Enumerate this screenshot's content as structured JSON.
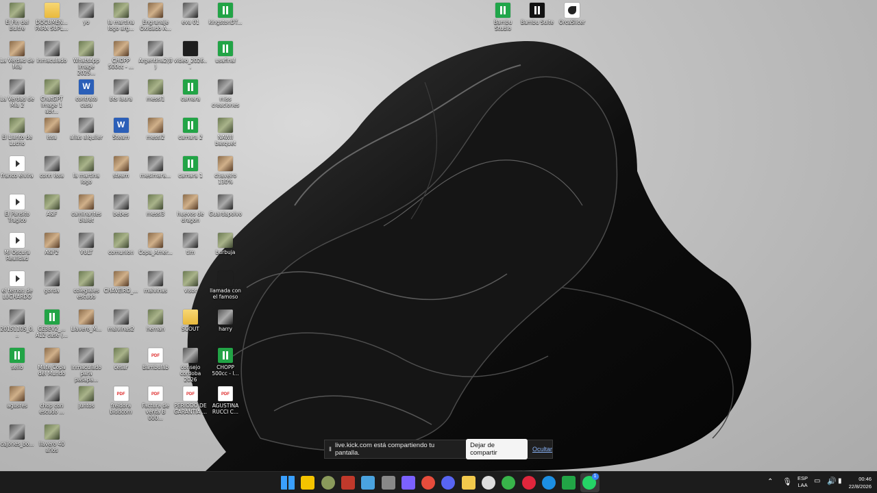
{
  "desktop": {
    "icons": [
      {
        "label": "El Fin del Buitre",
        "icon": "image-icon"
      },
      {
        "label": "DOCUMEN... PARA SUPL...",
        "icon": "folder-icon"
      },
      {
        "label": "yo",
        "icon": "image-icon"
      },
      {
        "label": "la martina logo arg...",
        "icon": "image-icon"
      },
      {
        "label": "Engranaje Oxidado A...",
        "icon": "image-icon"
      },
      {
        "label": "eva 01",
        "icon": "image-icon"
      },
      {
        "label": "kingstonDT...",
        "icon": "bambu-file-icon"
      },
      {
        "label": "La Verdad de Mia",
        "icon": "image-icon"
      },
      {
        "label": "inmaculado",
        "icon": "image-icon"
      },
      {
        "label": "WhatsApp Image 2025...",
        "icon": "image-icon"
      },
      {
        "label": "CHOPP 500cc - ...",
        "icon": "image-icon"
      },
      {
        "label": "Argentina2(8)",
        "icon": "image-icon"
      },
      {
        "label": "video_2026...",
        "icon": "video-icon"
      },
      {
        "label": "usafinal",
        "icon": "bambu-file-icon"
      },
      {
        "label": "La Verdad de Mia 2",
        "icon": "image-icon"
      },
      {
        "label": "ChatGPT Image 1 abr...",
        "icon": "image-icon"
      },
      {
        "label": "contrato casa",
        "icon": "word-icon"
      },
      {
        "label": "bts laura",
        "icon": "image-icon"
      },
      {
        "label": "messi1",
        "icon": "image-icon"
      },
      {
        "label": "camara",
        "icon": "bambu-file-icon"
      },
      {
        "label": "miss creaciones",
        "icon": "image-icon"
      },
      {
        "label": "El Llanto de Lucho",
        "icon": "image-icon"
      },
      {
        "label": "issa",
        "icon": "image-icon"
      },
      {
        "label": "alias alquiler",
        "icon": "image-icon"
      },
      {
        "label": "Steam",
        "icon": "word-icon"
      },
      {
        "label": "messi2",
        "icon": "image-icon"
      },
      {
        "label": "camara 2",
        "icon": "bambu-file-icon"
      },
      {
        "label": "NAWII basquet",
        "icon": "image-icon"
      },
      {
        "label": "franco elvira",
        "icon": "media-icon"
      },
      {
        "label": "conn issa",
        "icon": "image-icon"
      },
      {
        "label": "la martina logo",
        "icon": "image-icon"
      },
      {
        "label": "steam",
        "icon": "image-icon"
      },
      {
        "label": "mesimara...",
        "icon": "image-icon"
      },
      {
        "label": "camara 1",
        "icon": "bambu-file-icon"
      },
      {
        "label": "chaveiro 130%",
        "icon": "image-icon"
      },
      {
        "label": "El Pansito Tragico",
        "icon": "media-icon"
      },
      {
        "label": "A&F",
        "icon": "image-icon"
      },
      {
        "label": "caminantes bialet",
        "icon": "image-icon"
      },
      {
        "label": "bebes",
        "icon": "image-icon"
      },
      {
        "label": "messi3",
        "icon": "image-icon"
      },
      {
        "label": "huevos de dragon",
        "icon": "image-icon"
      },
      {
        "label": "Guardapolvo",
        "icon": "image-icon"
      },
      {
        "label": "Mi Oscura Realidad",
        "icon": "media-icon"
      },
      {
        "label": "A&F2",
        "icon": "image-icon"
      },
      {
        "label": "VULT",
        "icon": "image-icon"
      },
      {
        "label": "comunion",
        "icon": "image-icon"
      },
      {
        "label": "Copa_Amer...",
        "icon": "image-icon"
      },
      {
        "label": "tim",
        "icon": "image-icon"
      },
      {
        "label": "burbuja",
        "icon": "image-icon"
      },
      {
        "label": "el temon de LUCHARDO",
        "icon": "media-icon"
      },
      {
        "label": "gorda",
        "icon": "image-icon"
      },
      {
        "label": "colegiales escudo",
        "icon": "image-icon"
      },
      {
        "label": "CHAVEIRO_...",
        "icon": "image-icon"
      },
      {
        "label": "malvinas",
        "icon": "image-icon"
      },
      {
        "label": "visor",
        "icon": "image-icon"
      },
      {
        "label": "llamada con el famoso",
        "icon": "video-icon"
      },
      {
        "label": "20151105_0...",
        "icon": "image-icon"
      },
      {
        "label": "CE3EV2_... A12 case (...",
        "icon": "bambu-file-icon"
      },
      {
        "label": "Llavero_M...",
        "icon": "image-icon"
      },
      {
        "label": "malvinas2",
        "icon": "image-icon"
      },
      {
        "label": "hernan",
        "icon": "image-icon"
      },
      {
        "label": "SCOUT",
        "icon": "folder-icon"
      },
      {
        "label": "harry",
        "icon": "image-icon"
      },
      {
        "label": "sello",
        "icon": "bambu-file-icon"
      },
      {
        "label": "Mate Copa del Mundo",
        "icon": "image-icon"
      },
      {
        "label": "inmaculado para pasapa...",
        "icon": "image-icon"
      },
      {
        "label": "cesar",
        "icon": "image-icon"
      },
      {
        "label": "Bambulab",
        "icon": "pdf-icon"
      },
      {
        "label": "consejo cordoba 2026",
        "icon": "image-icon"
      },
      {
        "label": "CHOPP 500cc - l...",
        "icon": "bambu-file-icon"
      },
      {
        "label": "agusres",
        "icon": "image-icon"
      },
      {
        "label": "chop con escudo ...",
        "icon": "image-icon"
      },
      {
        "label": "juntos",
        "icon": "image-icon"
      },
      {
        "label": "freidora biddcom",
        "icon": "pdf-icon"
      },
      {
        "label": "Factura de venta B 000...",
        "icon": "pdf-icon"
      },
      {
        "label": "PERIODO DE GARANTIA ...",
        "icon": "pdf-icon"
      },
      {
        "label": "AGUSTINA RUCCI C...",
        "icon": "pdf-icon"
      },
      {
        "label": "cajones_bo...",
        "icon": "image-icon"
      },
      {
        "label": "llavero 40 años",
        "icon": "image-icon"
      }
    ],
    "top_right_icons": [
      {
        "label": "Bambu Studio",
        "icon": "bambu-studio-icon"
      },
      {
        "label": "Bambu Suite",
        "icon": "bambu-suite-icon"
      },
      {
        "label": "OrcaSlicer",
        "icon": "orcaslicer-icon"
      }
    ]
  },
  "share_bar": {
    "pause_glyph": "II",
    "message": "live.kick.com está compartiendo tu pantalla.",
    "stop_label": "Dejar de compartir",
    "hide_label": "Ocultar"
  },
  "taskbar": {
    "apps": [
      "windows-start-icon",
      "notes-icon",
      "terminal-icon",
      "app-red-icon",
      "water-drop-icon",
      "library-icon",
      "copilot-icon",
      "chrome-icon",
      "discord-icon",
      "file-explorer-icon",
      "github-icon",
      "xbox-icon",
      "opera-icon",
      "edge-icon",
      "bambu-studio-icon",
      "whatsapp-icon"
    ],
    "language_top": "ESP",
    "language_bottom": "LAA",
    "time": "00:46",
    "date": "22/8/2026",
    "whatsapp_badge": "1"
  },
  "colors": {
    "taskbar_bg": "#1c1c1c",
    "bambu_green": "#22a446",
    "link_blue": "#8ab4f8"
  }
}
